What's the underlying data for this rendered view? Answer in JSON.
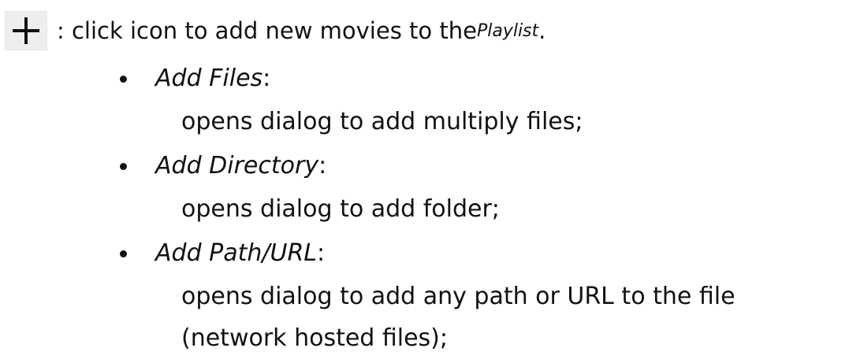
{
  "intro": {
    "icon": "plus-icon",
    "text_before": " : click icon to add new movies to the ",
    "playlist_word": "Playlist",
    "text_after": "."
  },
  "items": [
    {
      "title": "Add Files",
      "separator": " :",
      "description_lines": [
        "opens dialog to add multiply files;"
      ]
    },
    {
      "title": "Add Directory",
      "separator": " :",
      "description_lines": [
        "opens dialog to add folder;"
      ]
    },
    {
      "title": "Add Path/URL",
      "separator": " :",
      "description_lines": [
        "opens dialog to add any path or URL to the file",
        "(network hosted files);"
      ]
    }
  ]
}
